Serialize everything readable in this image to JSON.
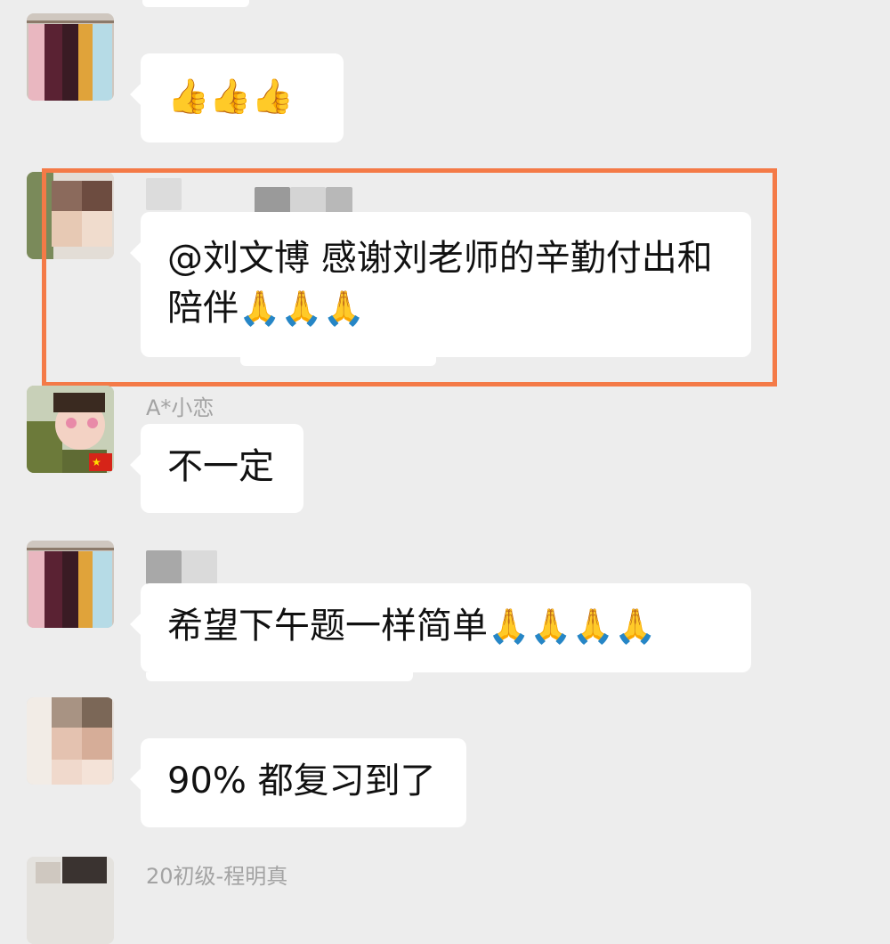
{
  "messages": [
    {
      "sender": "",
      "avatar": "clothing-rack-avatar",
      "content": {
        "text": "",
        "emoji": "👍👍👍"
      }
    },
    {
      "sender": "",
      "avatar": "pixelated-avatar",
      "content": {
        "text": "@刘文博  感谢刘老师的辛勤付出和陪伴",
        "emoji": "🙏🙏🙏"
      },
      "highlighted": true
    },
    {
      "sender": "A*小恋",
      "avatar": "selfie-avatar-with-flag",
      "content": {
        "text": "不一定",
        "emoji": ""
      }
    },
    {
      "sender": "",
      "avatar": "clothing-rack-avatar",
      "content": {
        "text": "希望下午题一样简单",
        "emoji": "🙏🙏🙏🙏"
      }
    },
    {
      "sender": "",
      "avatar": "pixelated-avatar",
      "content": {
        "text": "90% 都复习到了",
        "emoji": ""
      }
    },
    {
      "sender": "20初级-程明真",
      "avatar": "person-avatar",
      "content": {
        "text": "",
        "emoji": ""
      }
    }
  ],
  "colors": {
    "background": "#ededed",
    "bubble": "#ffffff",
    "highlight": "#f47a47",
    "sender_name": "#a3a3a3"
  }
}
